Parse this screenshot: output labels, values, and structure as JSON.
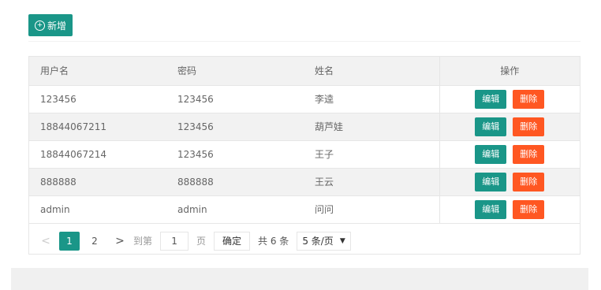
{
  "toolbar": {
    "add_label": "新增",
    "add_icon": "plus-circle-icon"
  },
  "table": {
    "headers": [
      "用户名",
      "密码",
      "姓名",
      "操作"
    ],
    "rows": [
      {
        "username": "123456",
        "password": "123456",
        "name": "李逵"
      },
      {
        "username": "18844067211",
        "password": "123456",
        "name": "葫芦娃"
      },
      {
        "username": "18844067214",
        "password": "123456",
        "name": "王子"
      },
      {
        "username": "888888",
        "password": "888888",
        "name": "王云"
      },
      {
        "username": "admin",
        "password": "admin",
        "name": "问问"
      }
    ],
    "edit_label": "编辑",
    "delete_label": "删除"
  },
  "pager": {
    "prev": "<",
    "pages": [
      "1",
      "2"
    ],
    "next": ">",
    "goto_label": "到第",
    "goto_value": "1",
    "page_unit": "页",
    "confirm_label": "确定",
    "total_label": "共 6 条",
    "page_size_label": "5 条/页"
  },
  "colors": {
    "primary": "#1a9688",
    "danger": "#ff5722"
  }
}
